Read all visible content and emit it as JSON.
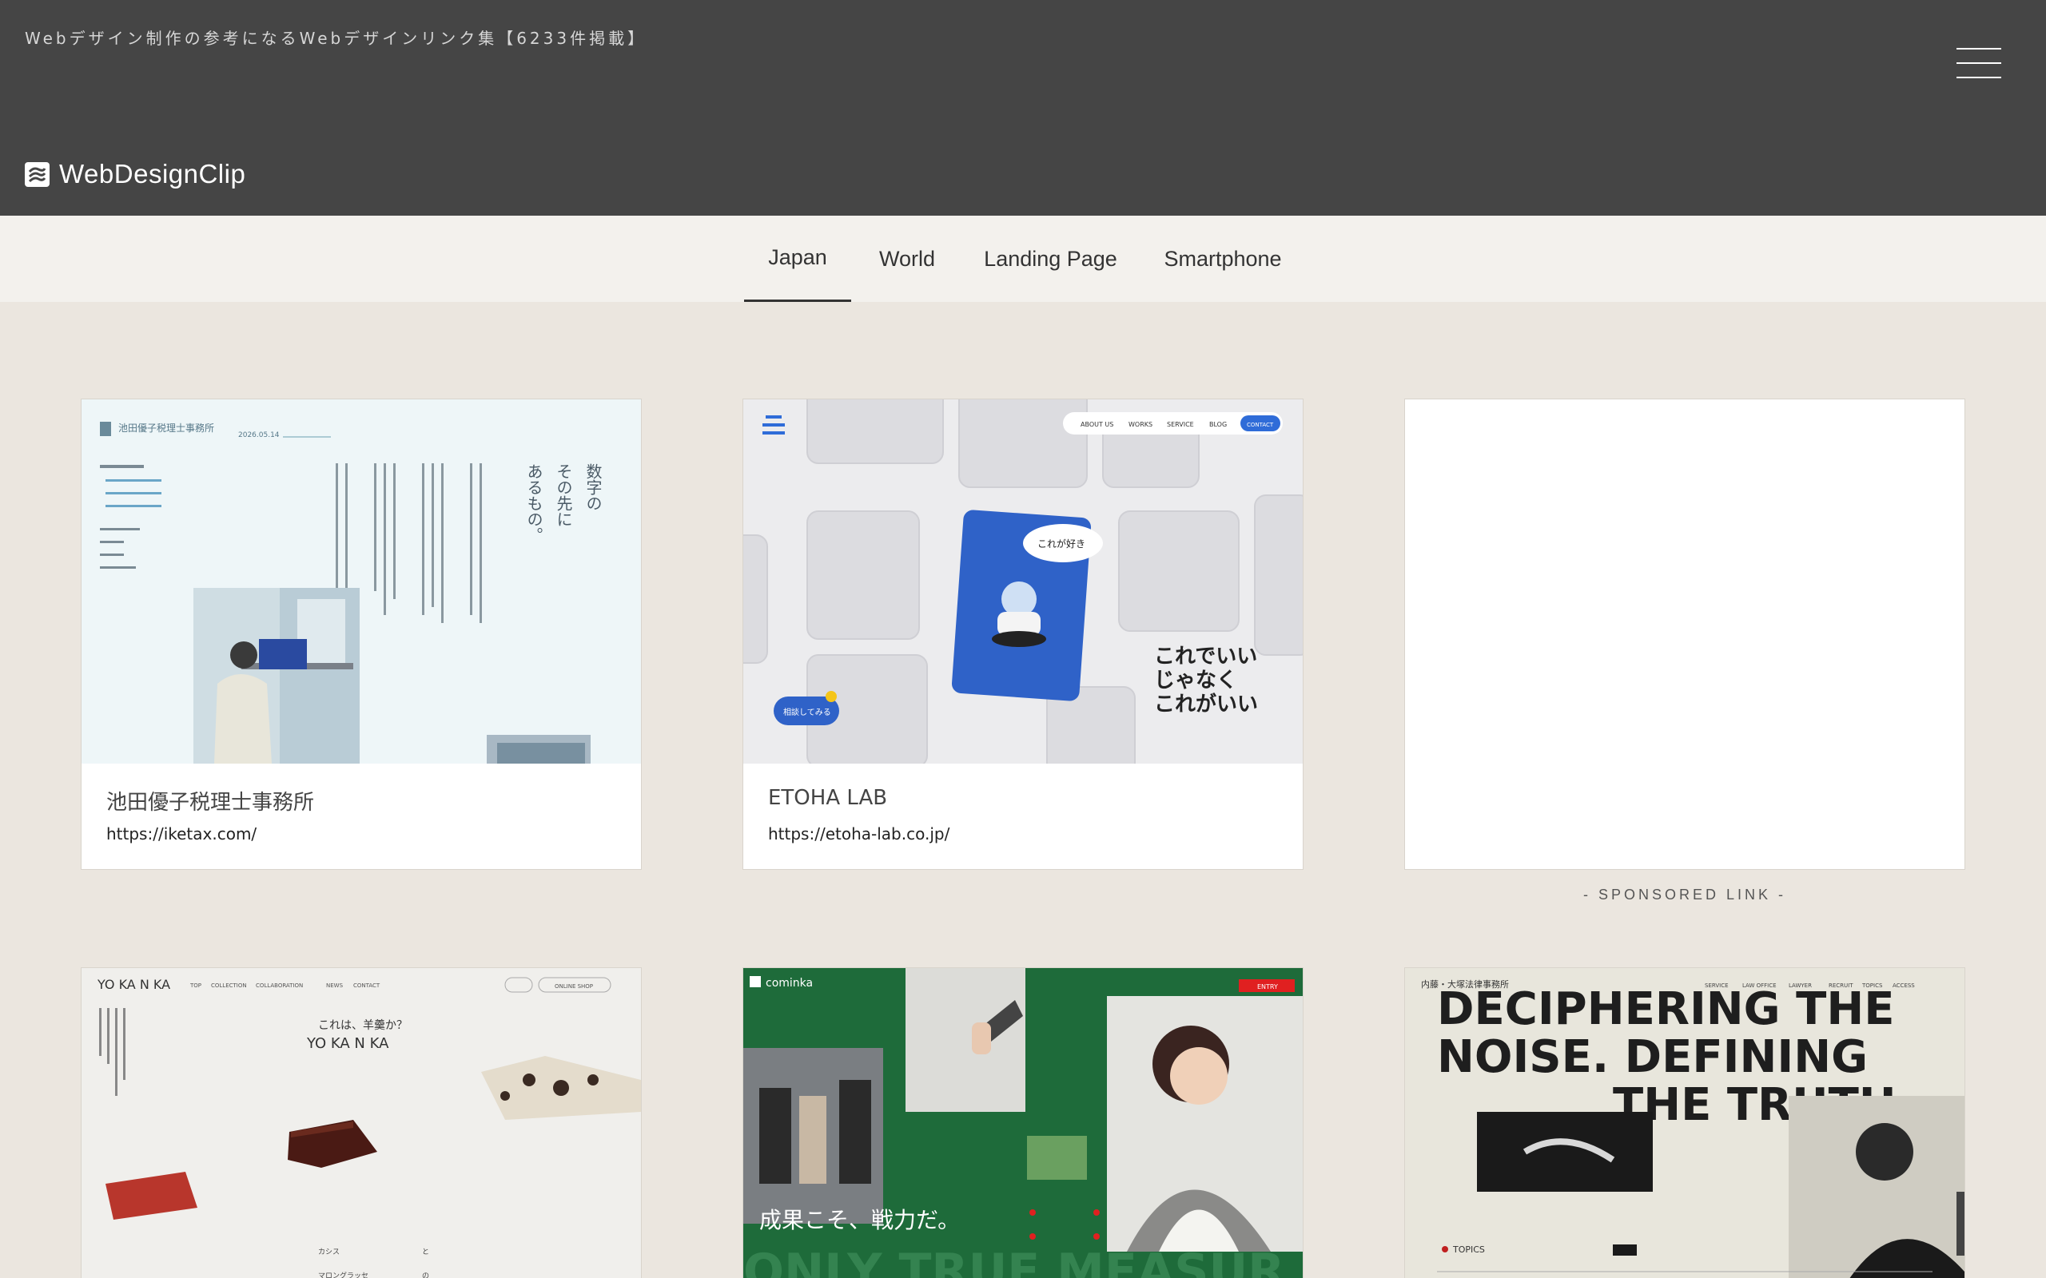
{
  "header": {
    "tagline": "Webデザイン制作の参考になるWebデザインリンク集【6233件掲載】",
    "logo_text": "WebDesignClip"
  },
  "tabs": [
    {
      "label": "Japan",
      "active": true
    },
    {
      "label": "World",
      "active": false
    },
    {
      "label": "Landing Page",
      "active": false
    },
    {
      "label": "Smartphone",
      "active": false
    }
  ],
  "cards": [
    {
      "title": "池田優子税理士事務所",
      "url": "https://iketax.com/",
      "thumb": {
        "header_name": "池田優子税理士事務所",
        "vertical_heading": "数字の その先に あるもの。",
        "date": "2026.05.14"
      }
    },
    {
      "title": "ETOHA LAB",
      "url": "https://etoha-lab.co.jp/",
      "thumb": {
        "nav": [
          "ABOUT US",
          "WORKS",
          "SERVICE",
          "BLOG",
          "CONTACT"
        ],
        "bubble": "これが好き",
        "headline": [
          "これでいい",
          "じゃなく",
          "これがいい"
        ],
        "cta": "相談してみる"
      }
    },
    {
      "title": "",
      "url": "",
      "sponsored_label": "- SPONSORED LINK -"
    },
    {
      "thumb": {
        "brand": "YO KA N KA",
        "nav": [
          "TOP",
          "COLLECTION",
          "COLLABORATION",
          "NEWS",
          "CONTACT"
        ],
        "tagline": "これは、羊羹か？",
        "sub": "YO KA N KA",
        "shop": "ONLINE SHOP"
      }
    },
    {
      "thumb": {
        "brand": "cominka",
        "entry": "ENTRY",
        "headline": "成果こそ、戦力だ。",
        "bg_text": "ONLY TRUE MEASUR"
      }
    },
    {
      "thumb": {
        "firm": "内藤・大塚法律事務所",
        "nav": [
          "SERVICE",
          "LAW OFFICE",
          "LAWYER",
          "RECRUIT",
          "TOPICS",
          "ACCESS"
        ],
        "headline": [
          "DECIPHERING THE",
          "NOISE.   DEFINING",
          "THE TRUTH."
        ],
        "topics": "TOPICS"
      }
    }
  ]
}
